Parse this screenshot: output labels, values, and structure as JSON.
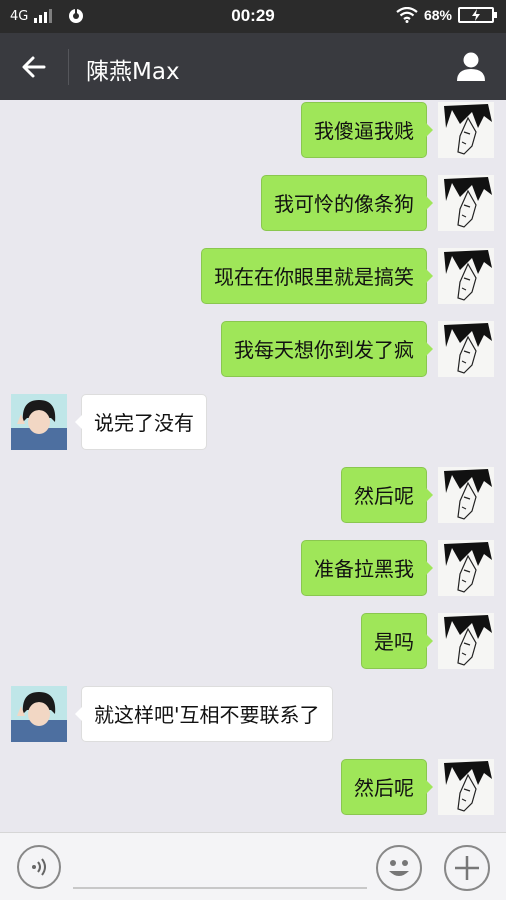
{
  "status_bar": {
    "network": "4G",
    "time": "00:29",
    "battery": "68%"
  },
  "header": {
    "title": "陳燕Max"
  },
  "messages": [
    {
      "side": "right",
      "text": "我傻逼我贱"
    },
    {
      "side": "right",
      "text": "我可怜的像条狗"
    },
    {
      "side": "right",
      "text": "现在在你眼里就是搞笑"
    },
    {
      "side": "right",
      "text": "我每天想你到发了疯"
    },
    {
      "side": "left",
      "text": "说完了没有"
    },
    {
      "side": "right",
      "text": "然后呢"
    },
    {
      "side": "right",
      "text": "准备拉黑我"
    },
    {
      "side": "right",
      "text": "是吗"
    },
    {
      "side": "left",
      "text": "就这样吧'互相不要联系了"
    },
    {
      "side": "right",
      "text": "然后呢"
    }
  ],
  "colors": {
    "title_bar": "#393a3f",
    "status_bar": "#2b2b2b",
    "chat_background": "#e9e8ee",
    "sent_bubble": "#9fe659",
    "received_bubble": "#ffffff"
  },
  "icons": {
    "back": "arrow-left-icon",
    "profile": "person-icon",
    "voice": "voice-icon",
    "emoji": "smiley-icon",
    "more": "plus-icon"
  }
}
